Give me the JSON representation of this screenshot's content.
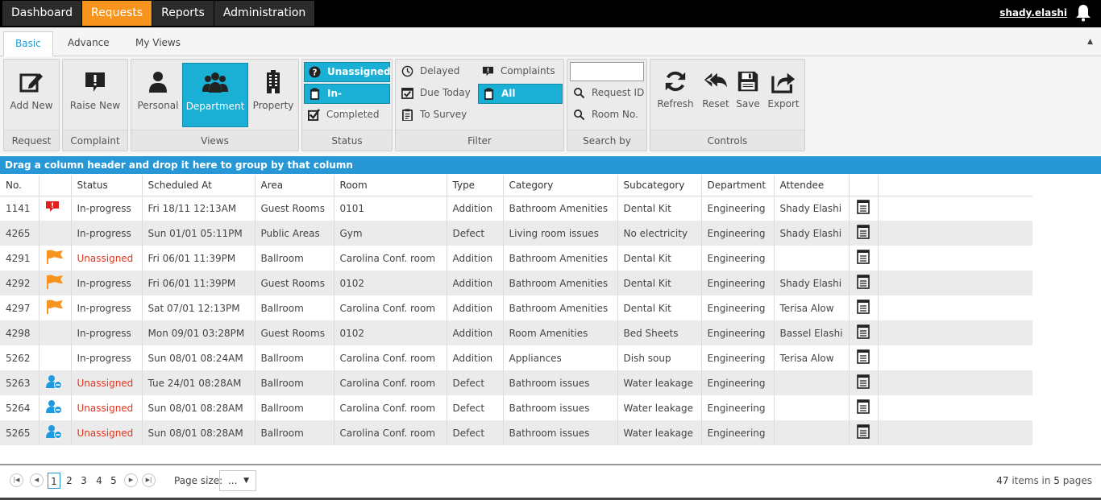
{
  "topnav": {
    "items": [
      "Dashboard",
      "Requests",
      "Reports",
      "Administration"
    ],
    "user": "shady.elashi"
  },
  "ribbon_tabs": [
    "Basic",
    "Advance",
    "My Views"
  ],
  "ribbon": {
    "request": {
      "label": "Request",
      "add_new": "Add New"
    },
    "complaint": {
      "label": "Complaint",
      "raise_new": "Raise New"
    },
    "views": {
      "label": "Views",
      "personal": "Personal",
      "department": "Department",
      "property": "Property"
    },
    "status": {
      "label": "Status",
      "unassigned": "Unassigned",
      "in_progress": "In-progress",
      "completed": "Completed"
    },
    "filter": {
      "label": "Filter",
      "delayed": "Delayed",
      "due_today": "Due Today",
      "to_survey": "To Survey",
      "complaints": "Complaints",
      "all": "All"
    },
    "search": {
      "label": "Search by",
      "request_id": "Request ID",
      "room_no": "Room No.",
      "value": ""
    },
    "controls": {
      "label": "Controls",
      "refresh": "Refresh",
      "reset": "Reset",
      "save": "Save",
      "export": "Export"
    }
  },
  "group_hint": "Drag a column header and drop it here to group by that column",
  "grid": {
    "columns": [
      "No.",
      "",
      "Status",
      "Scheduled At",
      "Area",
      "Room",
      "Type",
      "Category",
      "Subcategory",
      "Department",
      "Attendee",
      ""
    ],
    "rows": [
      {
        "no": "1141",
        "flag": "complaint",
        "status": "In-progress",
        "scheduled": "Fri 18/11 12:13AM",
        "area": "Guest Rooms",
        "room": "0101",
        "type": "Addition",
        "category": "Bathroom Amenities",
        "subcategory": "Dental Kit",
        "department": "Engineering",
        "attendee": "Shady Elashi"
      },
      {
        "no": "4265",
        "flag": "",
        "status": "In-progress",
        "scheduled": "Sun 01/01 05:11PM",
        "area": "Public Areas",
        "room": "Gym",
        "type": "Defect",
        "category": "Living room issues",
        "subcategory": "No electricity",
        "department": "Engineering",
        "attendee": "Shady Elashi"
      },
      {
        "no": "4291",
        "flag": "orange",
        "status": "Unassigned",
        "scheduled": "Fri 06/01 11:39PM",
        "area": "Ballroom",
        "room": "Carolina Conf. room",
        "type": "Addition",
        "category": "Bathroom Amenities",
        "subcategory": "Dental Kit",
        "department": "Engineering",
        "attendee": ""
      },
      {
        "no": "4292",
        "flag": "orange",
        "status": "In-progress",
        "scheduled": "Fri 06/01 11:39PM",
        "area": "Guest Rooms",
        "room": "0102",
        "type": "Addition",
        "category": "Bathroom Amenities",
        "subcategory": "Dental Kit",
        "department": "Engineering",
        "attendee": "Shady Elashi"
      },
      {
        "no": "4297",
        "flag": "orange",
        "status": "In-progress",
        "scheduled": "Sat 07/01 12:13PM",
        "area": "Ballroom",
        "room": "Carolina Conf. room",
        "type": "Addition",
        "category": "Bathroom Amenities",
        "subcategory": "Dental Kit",
        "department": "Engineering",
        "attendee": "Terisa Alow"
      },
      {
        "no": "4298",
        "flag": "",
        "status": "In-progress",
        "scheduled": "Mon 09/01 03:28PM",
        "area": "Guest Rooms",
        "room": "0102",
        "type": "Addition",
        "category": "Room Amenities",
        "subcategory": "Bed Sheets",
        "department": "Engineering",
        "attendee": "Bassel Elashi"
      },
      {
        "no": "5262",
        "flag": "",
        "status": "In-progress",
        "scheduled": "Sun 08/01 08:24AM",
        "area": "Ballroom",
        "room": "Carolina Conf. room",
        "type": "Addition",
        "category": "Appliances",
        "subcategory": "Dish soup",
        "department": "Engineering",
        "attendee": "Terisa Alow"
      },
      {
        "no": "5263",
        "flag": "user",
        "status": "Unassigned",
        "scheduled": "Tue 24/01 08:28AM",
        "area": "Ballroom",
        "room": "Carolina Conf. room",
        "type": "Defect",
        "category": "Bathroom issues",
        "subcategory": "Water leakage",
        "department": "Engineering",
        "attendee": ""
      },
      {
        "no": "5264",
        "flag": "user",
        "status": "Unassigned",
        "scheduled": "Sun 08/01 08:28AM",
        "area": "Ballroom",
        "room": "Carolina Conf. room",
        "type": "Defect",
        "category": "Bathroom issues",
        "subcategory": "Water leakage",
        "department": "Engineering",
        "attendee": ""
      },
      {
        "no": "5265",
        "flag": "user",
        "status": "Unassigned",
        "scheduled": "Sun 08/01 08:28AM",
        "area": "Ballroom",
        "room": "Carolina Conf. room",
        "type": "Defect",
        "category": "Bathroom issues",
        "subcategory": "Water leakage",
        "department": "Engineering",
        "attendee": ""
      }
    ]
  },
  "pager": {
    "pages": [
      "1",
      "2",
      "3",
      "4",
      "5"
    ],
    "current": "1",
    "page_size_label": "Page size:",
    "page_size_value": "...",
    "total_items": "47",
    "items_in": "items in",
    "total_pages": "5",
    "pages_word": "pages"
  },
  "colors": {
    "accent": "#1ab0d6",
    "active_nav": "#f7941d",
    "group_bar": "#2797d5",
    "unassigned": "#e8341c",
    "flag_orange": "#f7941d",
    "complaint_red": "#e02020",
    "user_blue": "#1e9be0"
  }
}
